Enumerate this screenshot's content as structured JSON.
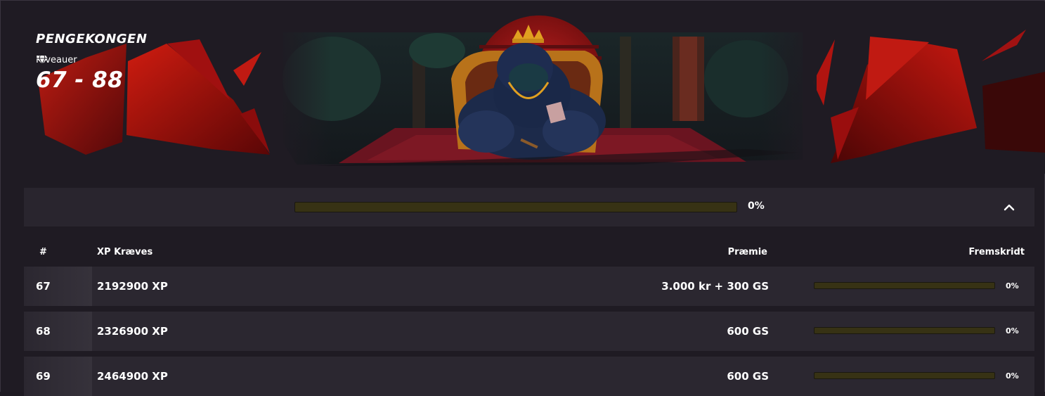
{
  "banner": {
    "title": "PENGEKONGEN",
    "levels_label": "Niveauer",
    "levels_range": "67 - 88",
    "icon": "diamond-icon",
    "illustration": "gorilla-king-on-throne"
  },
  "summary": {
    "progress_percent": 0,
    "progress_label": "0%",
    "toggle_icon": "chevron-up-icon"
  },
  "table": {
    "headers": {
      "num": "#",
      "xp": "XP Kræves",
      "prize": "Præmie",
      "progress": "Fremskridt"
    },
    "rows": [
      {
        "level": "67",
        "xp": "2192900 XP",
        "prize": "3.000 kr + 300 GS",
        "progress_percent": 0,
        "progress_label": "0%"
      },
      {
        "level": "68",
        "xp": "2326900 XP",
        "prize": "600 GS",
        "progress_percent": 0,
        "progress_label": "0%"
      },
      {
        "level": "69",
        "xp": "2464900 XP",
        "prize": "600 GS",
        "progress_percent": 0,
        "progress_label": "0%"
      }
    ]
  },
  "colors": {
    "background": "#1f1b23",
    "panel": "#29252e",
    "row": "#2b2730",
    "accent_red": "#b01010",
    "progress_track": "#373214",
    "progress_fill": "#c8b400"
  }
}
